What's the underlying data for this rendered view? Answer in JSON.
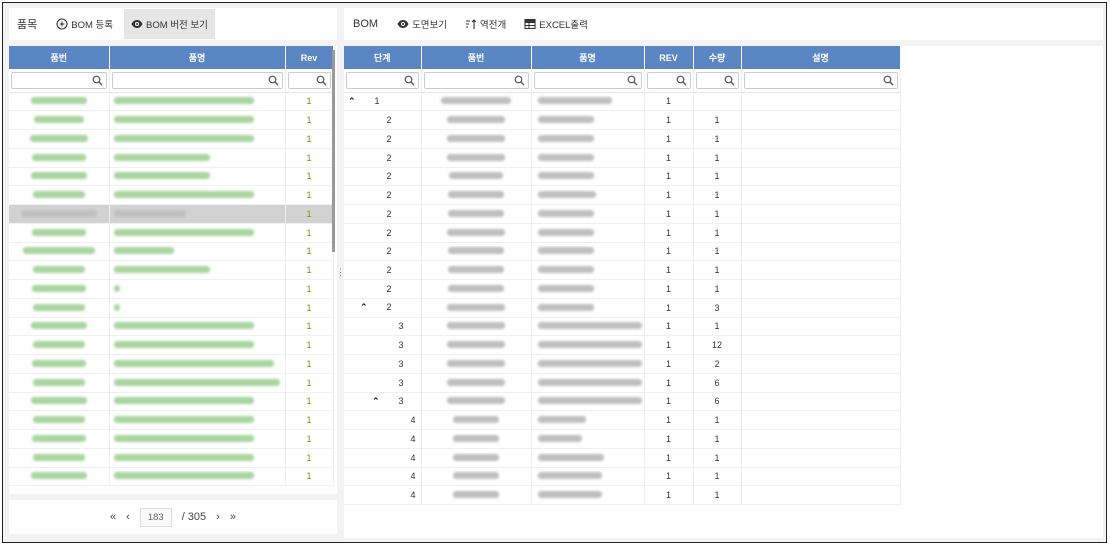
{
  "left_toolbar": {
    "title": "품목",
    "bom_register": "BOM 등록",
    "bom_version_view": "BOM 버전 보기"
  },
  "left_table": {
    "headers": [
      "품번",
      "품명",
      "Rev"
    ],
    "rows": [
      {
        "rev": "1"
      },
      {
        "rev": "1"
      },
      {
        "rev": "1"
      },
      {
        "rev": "1"
      },
      {
        "rev": "1"
      },
      {
        "rev": "1"
      },
      {
        "rev": "1",
        "selected": true
      },
      {
        "rev": "1"
      },
      {
        "rev": "1"
      },
      {
        "rev": "1"
      },
      {
        "rev": "1"
      },
      {
        "rev": "1"
      },
      {
        "rev": "1"
      },
      {
        "rev": "1"
      },
      {
        "rev": "1"
      },
      {
        "rev": "1"
      },
      {
        "rev": "1"
      },
      {
        "rev": "1"
      },
      {
        "rev": "1"
      },
      {
        "rev": "1"
      },
      {
        "rev": "1"
      }
    ]
  },
  "pager": {
    "first": "«",
    "prev": "‹",
    "current": "183",
    "total": "/ 305",
    "next": "›",
    "last": "»"
  },
  "right_toolbar": {
    "title": "BOM",
    "drawing_view": "도면보기",
    "reverse_expand": "역전개",
    "excel_export": "EXCEL출력"
  },
  "right_table": {
    "headers": [
      "단계",
      "품번",
      "품명",
      "REV",
      "수량",
      "설명"
    ],
    "rows": [
      {
        "level": "1",
        "expand": true,
        "rev": "1",
        "qty": ""
      },
      {
        "level": "2",
        "rev": "1",
        "qty": "1"
      },
      {
        "level": "2",
        "rev": "1",
        "qty": "1"
      },
      {
        "level": "2",
        "rev": "1",
        "qty": "1"
      },
      {
        "level": "2",
        "rev": "1",
        "qty": "1"
      },
      {
        "level": "2",
        "rev": "1",
        "qty": "1"
      },
      {
        "level": "2",
        "rev": "1",
        "qty": "1"
      },
      {
        "level": "2",
        "rev": "1",
        "qty": "1"
      },
      {
        "level": "2",
        "rev": "1",
        "qty": "1"
      },
      {
        "level": "2",
        "rev": "1",
        "qty": "1"
      },
      {
        "level": "2",
        "rev": "1",
        "qty": "1"
      },
      {
        "level": "2",
        "expand": true,
        "rev": "1",
        "qty": "3"
      },
      {
        "level": "3",
        "rev": "1",
        "qty": "1"
      },
      {
        "level": "3",
        "rev": "1",
        "qty": "12"
      },
      {
        "level": "3",
        "rev": "1",
        "qty": "2"
      },
      {
        "level": "3",
        "rev": "1",
        "qty": "6"
      },
      {
        "level": "3",
        "expand": true,
        "rev": "1",
        "qty": "6"
      },
      {
        "level": "4",
        "rev": "1",
        "qty": "1"
      },
      {
        "level": "4",
        "rev": "1",
        "qty": "1"
      },
      {
        "level": "4",
        "rev": "1",
        "qty": "1"
      },
      {
        "level": "4",
        "rev": "1",
        "qty": "1"
      },
      {
        "level": "4",
        "rev": "1",
        "qty": "1"
      }
    ]
  },
  "icons": {
    "add": "plus-circle-icon",
    "eye": "eye-icon",
    "search": "search-icon",
    "sort": "sort-icon",
    "table": "table-icon",
    "collapse": "chevron-up-icon"
  },
  "colors": {
    "header_bg": "#5a87c4",
    "selected_row": "#d2d2d2",
    "rev_green": "#8a8a00"
  }
}
